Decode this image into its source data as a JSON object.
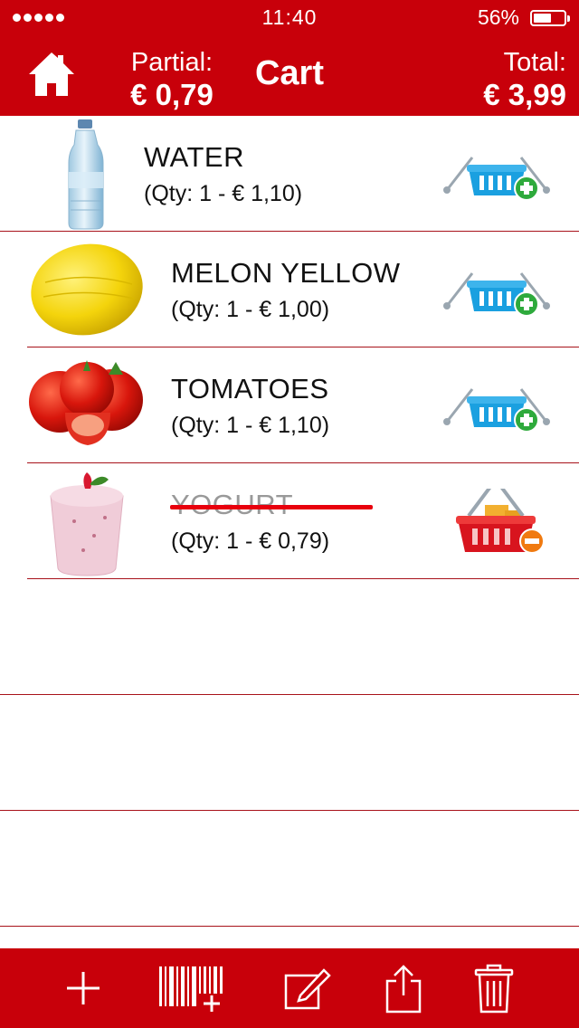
{
  "status_bar": {
    "time": "11:40",
    "battery_percent": "56%",
    "battery_level": 0.56,
    "signal_dots": 5
  },
  "nav": {
    "title": "Cart",
    "partial_label": "Partial:",
    "partial_value": "€ 0,79",
    "total_label": "Total:",
    "total_value": "€ 3,99"
  },
  "items": [
    {
      "name": "WATER",
      "detail": "(Qty: 1  - € 1,10)",
      "icon": "water-bottle",
      "action_icon": "basket-add-icon",
      "in_cart": false
    },
    {
      "name": "MELON YELLOW",
      "detail": "(Qty: 1  - € 1,00)",
      "icon": "yellow-melon",
      "action_icon": "basket-add-icon",
      "in_cart": false
    },
    {
      "name": "TOMATOES",
      "detail": "(Qty: 1  - € 1,10)",
      "icon": "tomatoes",
      "action_icon": "basket-add-icon",
      "in_cart": false
    },
    {
      "name": "YOGURT",
      "detail": "(Qty: 1  - € 0,79)",
      "icon": "strawberry-yogurt",
      "action_icon": "basket-remove-icon",
      "in_cart": true
    }
  ],
  "colors": {
    "brand_red": "#c8000a",
    "divider": "#a8121a",
    "strike": "#e8000d",
    "basket_blue": "#1aa0e0",
    "basket_red": "#d8141e",
    "plus_green": "#2eaa3c",
    "minus_orange": "#f07a10"
  },
  "toolbar": [
    "add-icon",
    "barcode-add-icon",
    "edit-icon",
    "share-icon",
    "trash-icon"
  ]
}
